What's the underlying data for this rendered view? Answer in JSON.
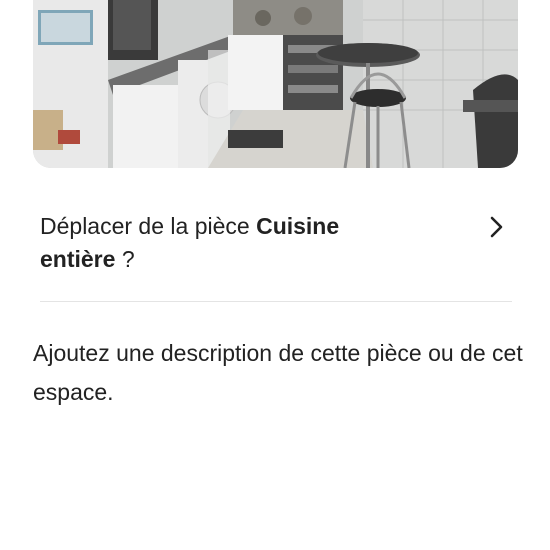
{
  "room_photo": {
    "subject": "kitchen"
  },
  "move_room": {
    "prefix": "Déplacer de la pièce",
    "room_name_line1": "Cuisine",
    "room_name_line2": "entière",
    "suffix": "?"
  },
  "description": {
    "prompt": "Ajoutez une description de cette pièce ou de cet espace."
  },
  "icons": {
    "chevron": "chevron-right-icon"
  }
}
